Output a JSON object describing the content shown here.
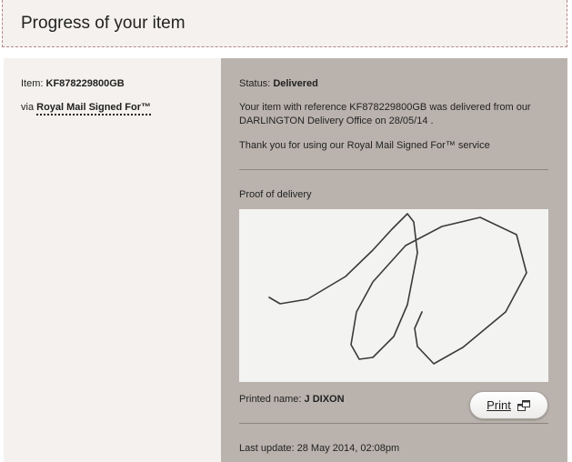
{
  "header": {
    "title": "Progress of your item"
  },
  "item": {
    "label": "Item:",
    "reference": "KF878229800GB",
    "via_label": "via",
    "service_link": "Royal Mail Signed For™"
  },
  "status": {
    "label": "Status:",
    "value": "Delivered",
    "message_line1": "Your item with reference KF878229800GB was delivered from our",
    "message_line2": "DARLINGTON Delivery Office on 28/05/14 .",
    "thanks": "Thank you for using our Royal Mail Signed For™ service"
  },
  "proof": {
    "heading": "Proof of delivery",
    "printed_name_label": "Printed name:",
    "printed_name": "J DIXON",
    "print_button": "Print",
    "print_icon": "popup-window-icon"
  },
  "last_update": {
    "label": "Last update:",
    "value": "28 May 2014, 02:08pm"
  }
}
